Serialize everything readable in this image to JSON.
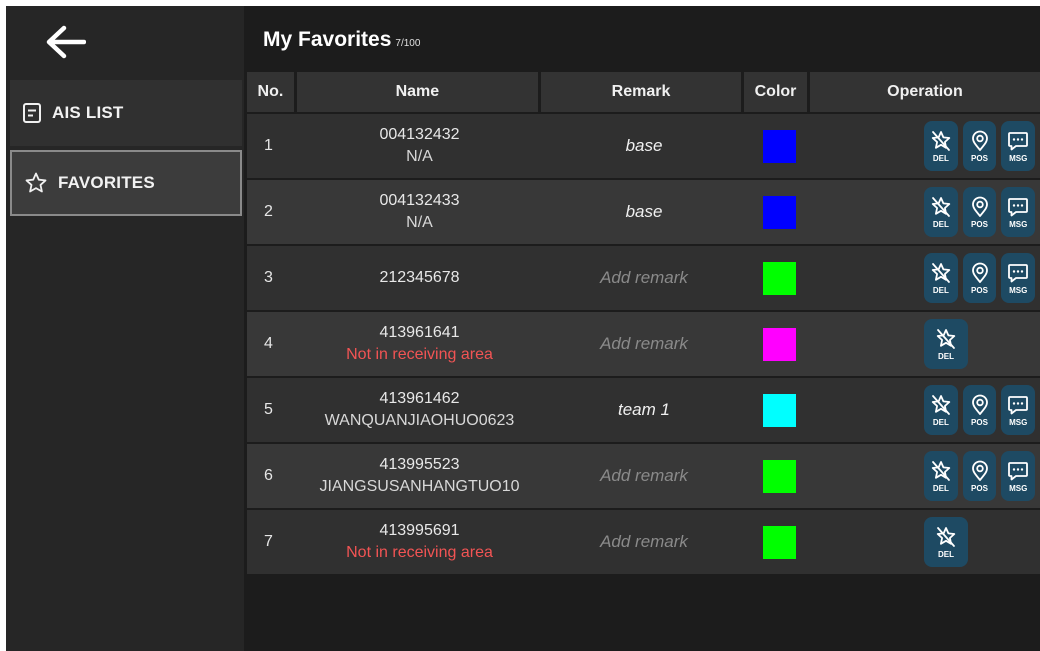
{
  "sidebar": {
    "items": [
      {
        "label": "AIS LIST",
        "icon": "list-icon"
      },
      {
        "label": "FAVORITES",
        "icon": "star-icon"
      }
    ]
  },
  "header": {
    "title": "My Favorites",
    "count": "7/100"
  },
  "table": {
    "columns": [
      "No.",
      "Name",
      "Remark",
      "Color",
      "Operation"
    ],
    "ops": {
      "del": "DEL",
      "pos": "POS",
      "msg": "MSG"
    },
    "rows": [
      {
        "no": "1",
        "mmsi": "004132432",
        "name": "N/A",
        "name_warning": false,
        "remark": "base",
        "remark_placeholder": false,
        "color": "#0000ff",
        "ops": [
          "DEL",
          "POS",
          "MSG"
        ]
      },
      {
        "no": "2",
        "mmsi": "004132433",
        "name": "N/A",
        "name_warning": false,
        "remark": "base",
        "remark_placeholder": false,
        "color": "#0000ff",
        "ops": [
          "DEL",
          "POS",
          "MSG"
        ]
      },
      {
        "no": "3",
        "mmsi": "212345678",
        "name": "",
        "name_warning": false,
        "remark": "Add remark",
        "remark_placeholder": true,
        "color": "#00ff00",
        "ops": [
          "DEL",
          "POS",
          "MSG"
        ]
      },
      {
        "no": "4",
        "mmsi": "413961641",
        "name": "Not in receiving area",
        "name_warning": true,
        "remark": "Add remark",
        "remark_placeholder": true,
        "color": "#ff00ff",
        "ops": [
          "DEL"
        ]
      },
      {
        "no": "5",
        "mmsi": "413961462",
        "name": "WANQUANJIAOHUO0623",
        "name_warning": false,
        "remark": "team 1",
        "remark_placeholder": false,
        "color": "#00ffff",
        "ops": [
          "DEL",
          "POS",
          "MSG"
        ]
      },
      {
        "no": "6",
        "mmsi": "413995523",
        "name": "JIANGSUSANHANGTUO10",
        "name_warning": false,
        "remark": "Add remark",
        "remark_placeholder": true,
        "color": "#00ff00",
        "ops": [
          "DEL",
          "POS",
          "MSG"
        ]
      },
      {
        "no": "7",
        "mmsi": "413995691",
        "name": "Not in receiving area",
        "name_warning": true,
        "remark": "Add remark",
        "remark_placeholder": true,
        "color": "#00ff00",
        "ops": [
          "DEL"
        ]
      }
    ]
  },
  "colors": {
    "op_button": "#1e4a63",
    "warning_text": "#f25454",
    "placeholder_text": "#8a8a8a"
  }
}
